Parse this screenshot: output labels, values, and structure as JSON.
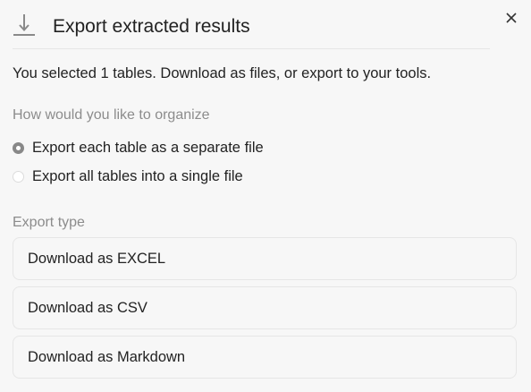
{
  "dialog": {
    "title": "Export extracted results",
    "header_icon": "download-icon",
    "close_icon": "close-icon",
    "subtitle": "You selected 1 tables. Download as files, or export to your tools."
  },
  "organize": {
    "label": "How would you like to organize",
    "options": [
      {
        "label": "Export each table as a separate file",
        "selected": true
      },
      {
        "label": "Export all tables into a single file",
        "selected": false
      }
    ]
  },
  "export_type": {
    "label": "Export type",
    "options": [
      {
        "label": "Download as EXCEL"
      },
      {
        "label": "Download as CSV"
      },
      {
        "label": "Download as Markdown"
      }
    ]
  }
}
